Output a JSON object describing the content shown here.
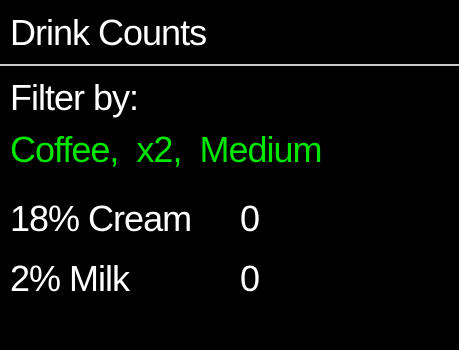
{
  "header": {
    "title": "Drink Counts"
  },
  "filter": {
    "label": "Filter by:",
    "value": "Coffee,  x2,  Medium"
  },
  "counts": [
    {
      "name": "18% Cream",
      "count": "0"
    },
    {
      "name": "2% Milk",
      "count": "0"
    }
  ],
  "colors": {
    "background": "#000000",
    "text": "#ffffff",
    "filter_value": "#00e600",
    "divider": "#c8c8c8"
  }
}
